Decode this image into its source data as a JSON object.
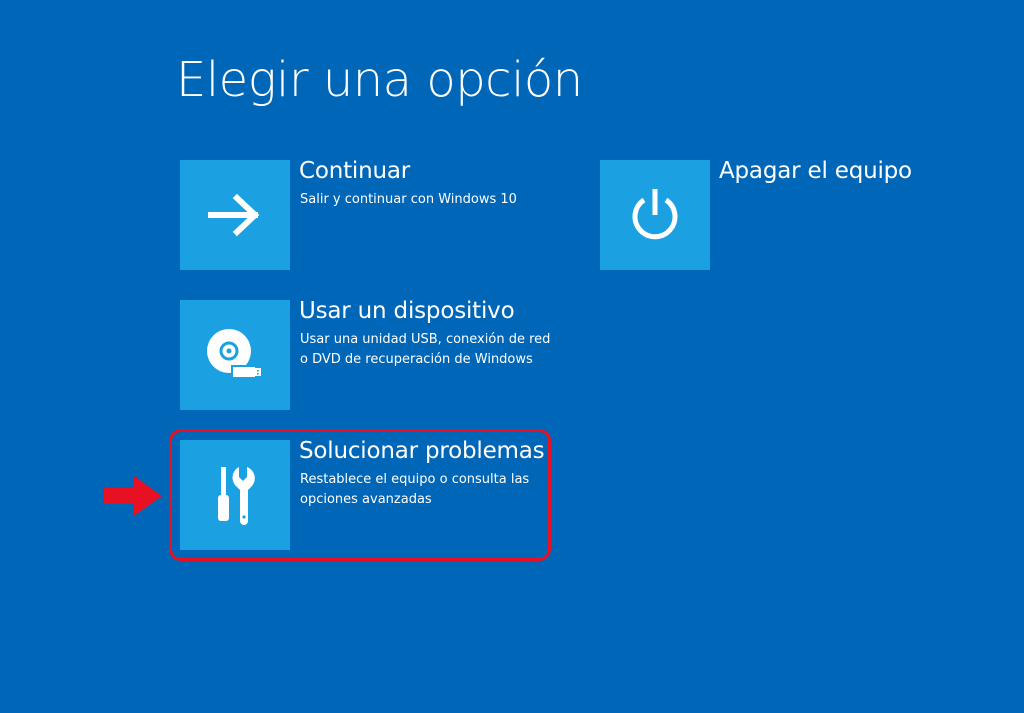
{
  "page": {
    "title": "Elegir una opción"
  },
  "options": [
    {
      "id": "continue",
      "title": "Continuar",
      "description": "Salir y continuar con Windows 10",
      "icon": "arrow-right-icon"
    },
    {
      "id": "device",
      "title": "Usar un dispositivo",
      "description": "Usar una unidad USB, conexión de red o DVD de recuperación de Windows",
      "icon": "disc-usb-icon"
    },
    {
      "id": "troubleshoot",
      "title": "Solucionar problemas",
      "description": "Restablece el equipo o consulta las opciones avanzadas",
      "icon": "tools-icon",
      "highlighted": true
    },
    {
      "id": "shutdown",
      "title": "Apagar el equipo",
      "description": "",
      "icon": "power-icon"
    }
  ],
  "annotation": {
    "highlight_color": "#e81123",
    "pointer": "red-arrow-icon"
  },
  "colors": {
    "background": "#0067b8",
    "tile": "#1ba1e2",
    "text": "#ffffff"
  }
}
